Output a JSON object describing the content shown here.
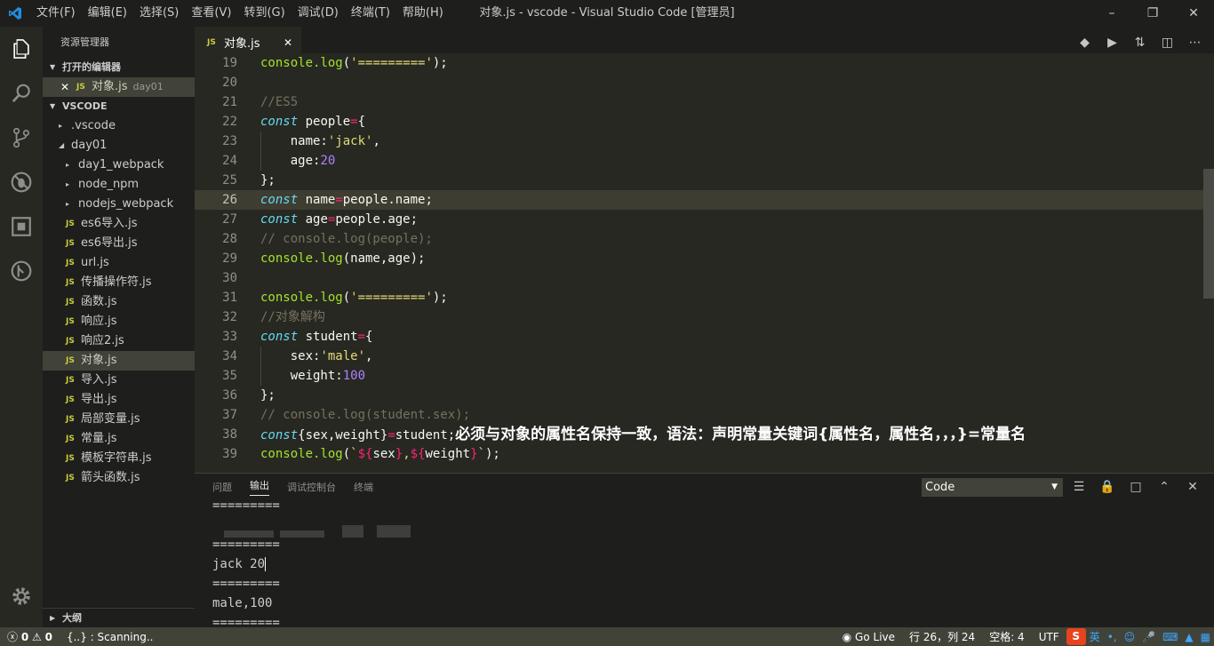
{
  "window": {
    "menu": [
      "文件(F)",
      "编辑(E)",
      "选择(S)",
      "查看(V)",
      "转到(G)",
      "调试(D)",
      "终端(T)",
      "帮助(H)"
    ],
    "title": "对象.js - vscode - Visual Studio Code [管理员]"
  },
  "sidebar": {
    "title": "资源管理器",
    "open_editors_header": "打开的编辑器",
    "open_editor": {
      "name": "对象.js",
      "dir": "day01"
    },
    "workspace_header": "VSCODE",
    "tree": [
      {
        "label": ".vscode",
        "kind": "folder"
      },
      {
        "label": "day01",
        "kind": "folder-open"
      },
      {
        "label": "day1_webpack",
        "kind": "folder"
      },
      {
        "label": "node_npm",
        "kind": "folder"
      },
      {
        "label": "nodejs_webpack",
        "kind": "folder"
      },
      {
        "label": "es6导入.js",
        "kind": "js"
      },
      {
        "label": "es6导出.js",
        "kind": "js"
      },
      {
        "label": "url.js",
        "kind": "js"
      },
      {
        "label": "传播操作符.js",
        "kind": "js"
      },
      {
        "label": "函数.js",
        "kind": "js"
      },
      {
        "label": "响应.js",
        "kind": "js"
      },
      {
        "label": "响应2.js",
        "kind": "js"
      },
      {
        "label": "对象.js",
        "kind": "js",
        "selected": true
      },
      {
        "label": "导入.js",
        "kind": "js"
      },
      {
        "label": "导出.js",
        "kind": "js"
      },
      {
        "label": "局部变量.js",
        "kind": "js"
      },
      {
        "label": "常量.js",
        "kind": "js"
      },
      {
        "label": "模板字符串.js",
        "kind": "js"
      },
      {
        "label": "箭头函数.js",
        "kind": "js"
      }
    ],
    "outline_header": "大纲"
  },
  "tab": {
    "icon_text": "JS",
    "name": "对象.js"
  },
  "editor": {
    "current_line": 26,
    "lines": [
      {
        "n": "19",
        "tokens": [
          [
            "f",
            "console.log"
          ],
          [
            "v",
            "("
          ],
          [
            "s",
            "'========='"
          ],
          [
            "v",
            ");"
          ]
        ]
      },
      {
        "n": "20",
        "tokens": []
      },
      {
        "n": "21",
        "tokens": [
          [
            "c",
            "//ES5"
          ]
        ]
      },
      {
        "n": "22",
        "tokens": [
          [
            "k",
            "const"
          ],
          [
            "v",
            " people"
          ],
          [
            "o",
            "="
          ],
          [
            "v",
            "{"
          ]
        ]
      },
      {
        "n": "23",
        "indent": true,
        "tokens": [
          [
            "v",
            "    name:"
          ],
          [
            "s",
            "'jack'"
          ],
          [
            "v",
            ","
          ]
        ]
      },
      {
        "n": "24",
        "indent": true,
        "tokens": [
          [
            "v",
            "    age:"
          ],
          [
            "n",
            "20"
          ]
        ]
      },
      {
        "n": "25",
        "tokens": [
          [
            "v",
            "};"
          ]
        ]
      },
      {
        "n": "26",
        "tokens": [
          [
            "k",
            "const"
          ],
          [
            "v",
            " name"
          ],
          [
            "o",
            "="
          ],
          [
            "v",
            "people.name;"
          ]
        ]
      },
      {
        "n": "27",
        "tokens": [
          [
            "k",
            "const"
          ],
          [
            "v",
            " age"
          ],
          [
            "o",
            "="
          ],
          [
            "v",
            "people.age;"
          ]
        ]
      },
      {
        "n": "28",
        "tokens": [
          [
            "c",
            "// console.log(people);"
          ]
        ]
      },
      {
        "n": "29",
        "tokens": [
          [
            "f",
            "console.log"
          ],
          [
            "v",
            "(name,age);"
          ]
        ]
      },
      {
        "n": "30",
        "tokens": []
      },
      {
        "n": "31",
        "tokens": [
          [
            "f",
            "console.log"
          ],
          [
            "v",
            "("
          ],
          [
            "s",
            "'========='"
          ],
          [
            "v",
            ");"
          ]
        ]
      },
      {
        "n": "32",
        "tokens": [
          [
            "c",
            "//对象解构"
          ]
        ]
      },
      {
        "n": "33",
        "tokens": [
          [
            "k",
            "const"
          ],
          [
            "v",
            " student"
          ],
          [
            "o",
            "="
          ],
          [
            "v",
            "{"
          ]
        ]
      },
      {
        "n": "34",
        "indent": true,
        "tokens": [
          [
            "v",
            "    sex:"
          ],
          [
            "s",
            "'male'"
          ],
          [
            "v",
            ","
          ]
        ]
      },
      {
        "n": "35",
        "indent": true,
        "tokens": [
          [
            "v",
            "    weight:"
          ],
          [
            "n",
            "100"
          ]
        ]
      },
      {
        "n": "36",
        "tokens": [
          [
            "v",
            "};"
          ]
        ]
      },
      {
        "n": "37",
        "tokens": [
          [
            "c",
            "// console.log(student.sex);"
          ]
        ]
      },
      {
        "n": "38",
        "tokens": [
          [
            "k",
            "const"
          ],
          [
            "v",
            "{sex,weight}"
          ],
          [
            "o",
            "="
          ],
          [
            "v",
            "student;"
          ],
          [
            "note",
            "必须与对象的属性名保持一致，语法：声明常量关键词{属性名，属性名，，，}=常量名"
          ]
        ]
      },
      {
        "n": "39",
        "tokens": [
          [
            "f",
            "console.log"
          ],
          [
            "v",
            "("
          ],
          [
            "s",
            "`"
          ],
          [
            "o",
            "${"
          ],
          [
            "v",
            "sex"
          ],
          [
            "o",
            "}"
          ],
          [
            "s",
            ","
          ],
          [
            "o",
            "${"
          ],
          [
            "v",
            "weight"
          ],
          [
            "o",
            "}"
          ],
          [
            "s",
            "`"
          ],
          [
            "v",
            ");"
          ]
        ]
      }
    ]
  },
  "panel": {
    "tabs": [
      "问题",
      "输出",
      "调试控制台",
      "终端"
    ],
    "active_tab": "输出",
    "channel": "Code",
    "output_lines": [
      "=========",
      "",
      "=========",
      "jack 20",
      "=========",
      "male,100",
      "========="
    ]
  },
  "status": {
    "errors": "0",
    "warnings": "0",
    "scanning": "{..} : Scanning..",
    "go_live": "Go Live",
    "position": "行 26，列 24",
    "spaces": "空格: 4",
    "encoding": "UTF",
    "ime_lang": "英"
  }
}
